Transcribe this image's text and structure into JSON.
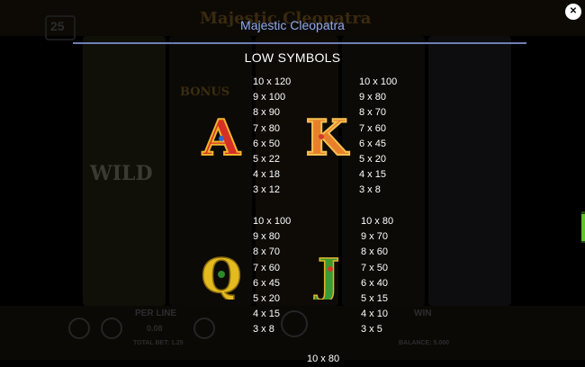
{
  "header": {
    "title": "Majestic Cleopatra"
  },
  "section": {
    "title": "LOW SYMBOLS"
  },
  "background": {
    "logo_text": "Majestic Cleopatra",
    "lines_count": "25",
    "bonus_text": "BONUS",
    "wild_text": "WILD",
    "per_line_label": "PER LINE",
    "per_line_value": "0.08",
    "win_label": "WIN",
    "total_bet_label": "TOTAL BET: 1.25",
    "balance_label": "BALANCE: 5.000"
  },
  "symbols": [
    {
      "name": "A",
      "icon": "letter-a-symbol-icon",
      "color": "#e83e2e",
      "payouts": [
        "10 x 120",
        "9 x 100",
        "8 x 90",
        "7 x 80",
        "6 x 50",
        "5 x 22",
        "4 x 18",
        "3 x 12"
      ]
    },
    {
      "name": "K",
      "icon": "letter-k-symbol-icon",
      "color": "#e8852a",
      "payouts": [
        "10 x 100",
        "9 x 80",
        "8 x 70",
        "7 x 60",
        "6 x 45",
        "5 x 20",
        "4 x 15",
        "3 x 8"
      ]
    },
    {
      "name": "Q",
      "icon": "letter-q-symbol-icon",
      "color": "#e8c52a",
      "payouts": [
        "10 x 100",
        "9 x 80",
        "8 x 70",
        "7 x 60",
        "6 x 45",
        "5 x 20",
        "4 x 15",
        "3 x 8"
      ]
    },
    {
      "name": "J",
      "icon": "letter-j-symbol-icon",
      "color": "#3fa33a",
      "payouts": [
        "10 x 80",
        "9 x 70",
        "8 x 60",
        "7 x 50",
        "6 x 40",
        "5 x 15",
        "4 x 10",
        "3 x 5"
      ]
    }
  ],
  "next_partial": "10 x 80"
}
